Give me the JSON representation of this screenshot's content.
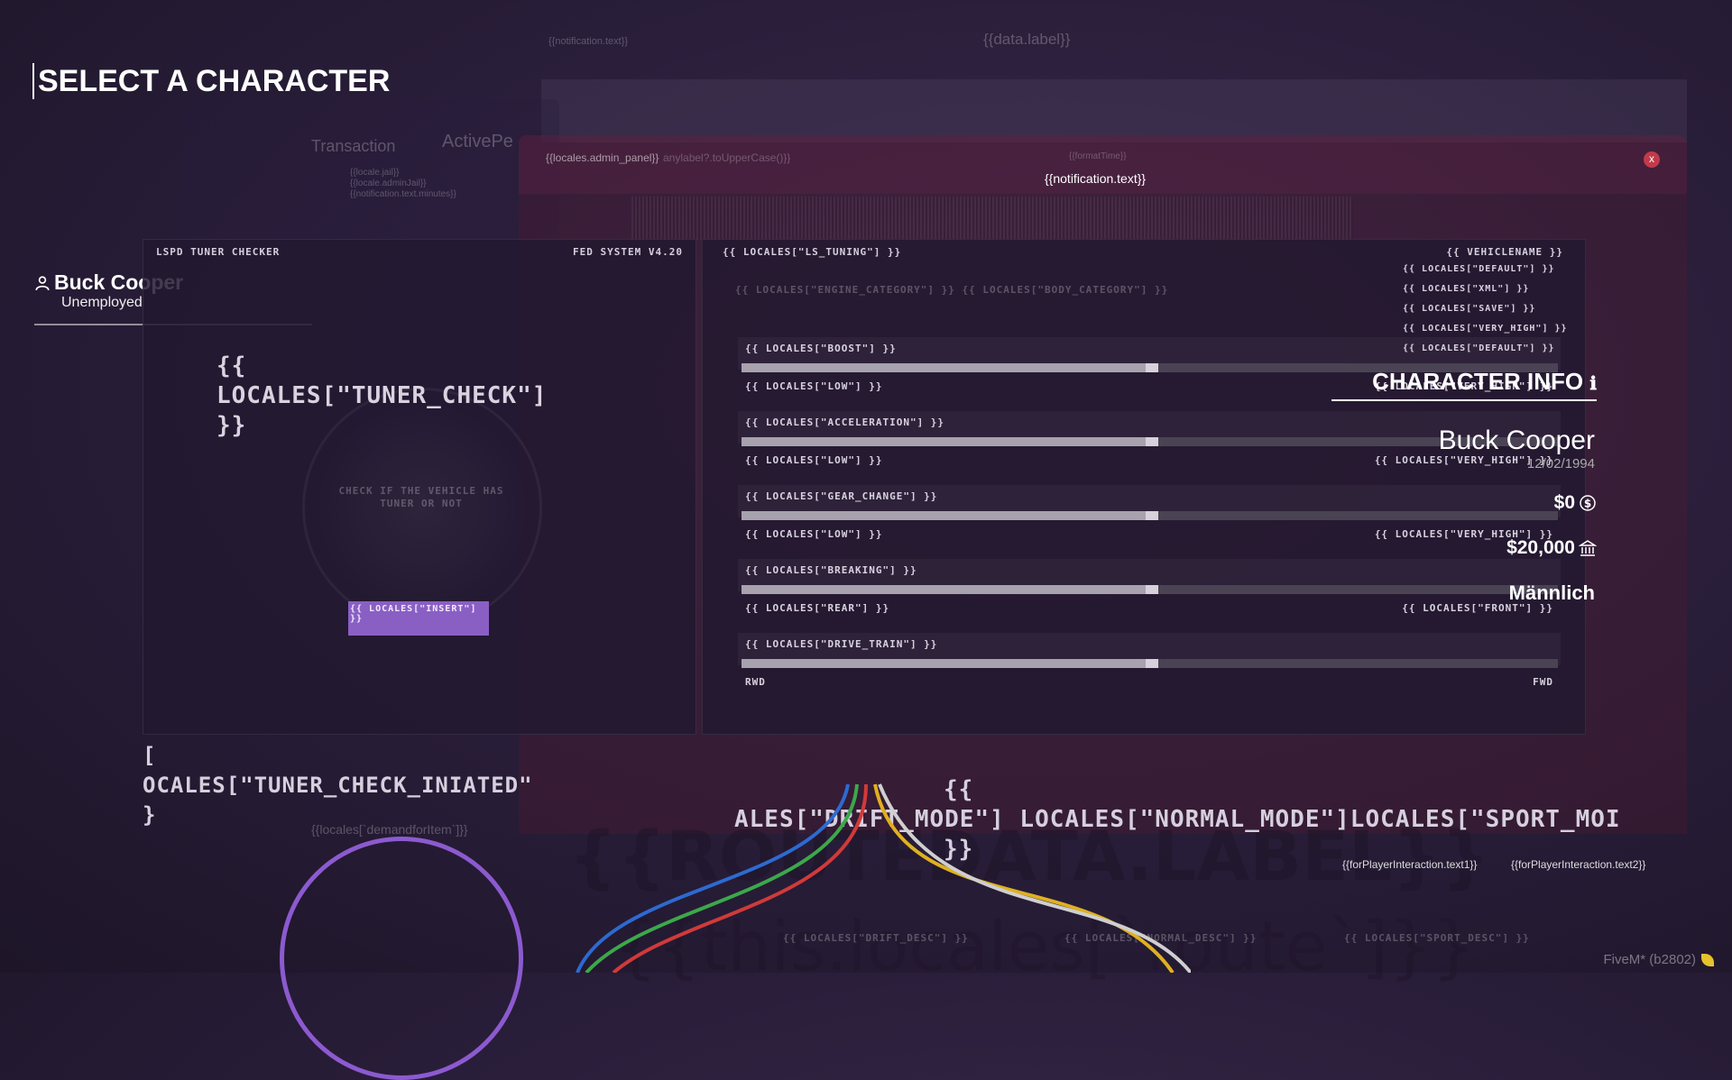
{
  "page": {
    "title": "SELECT A CHARACTER"
  },
  "character": {
    "name": "Buck Cooper",
    "job": "Unemployed"
  },
  "background": {
    "data_label": "{{data.label}}",
    "admin_panel": "{{locales.admin_panel}}",
    "upper_case": "anylabel?.toUpperCase()}}",
    "format_time": "{{formatTime}}",
    "notification": "{{notification.text}}",
    "notification_small": "{{notification.text}}",
    "transaction": "Transaction",
    "active": "ActivePe",
    "locale_jail": "{{locale.jail}}",
    "locale_admin_jail": "{{locale.adminJail}}",
    "notif_minutes": "{{notification.text.minutes}}",
    "demand": "{{locales[`demandforItem`]}}",
    "interaction1": "{{forPlayerInteraction.text1}}",
    "interaction2": "{{forPlayerInteraction.text2}}",
    "routedata": "{{ROUTEDATA.LABEL}}",
    "this_route": "{{this.locales[`route`]}}",
    "build": "FiveM* (b2802)"
  },
  "tuner": {
    "left_header": "LSPD TUNER CHECKER",
    "right_header": "FED SYSTEM V4.20",
    "title_open": "{{",
    "title_key": "LOCALES[\"TUNER_CHECK\"]",
    "title_close": "}}",
    "check_desc": "CHECK IF THE VEHICLE HAS TUNER OR NOT",
    "insert_button": "{{ LOCALES[\"INSERT\"] }}",
    "initiated_open": "[",
    "initiated": "OCALES[\"TUNER_CHECK_INIATED\"",
    "initiated_close": "}"
  },
  "tuning": {
    "header_left": "{{ LOCALES[\"LS_TUNING\"] }}",
    "header_right": "{{ VEHICLENAME }}",
    "tabs": "{{ LOCALES[\"ENGINE_CATEGORY\"]  }}   {{ LOCALES[\"BODY_CATEGORY\"] }}",
    "menu": [
      "{{ LOCALES[\"DEFAULT\"] }}",
      "{{ LOCALES[\"XML\"] }}",
      "{{ LOCALES[\"SAVE\"] }}",
      "{{ LOCALES[\"VERY_HIGH\"] }}",
      "{{ LOCALES[\"DEFAULT\"] }}"
    ],
    "stats": [
      {
        "label": "{{ LOCALES[\"BOOST\"] }}",
        "low": "{{ LOCALES[\"LOW\"] }}",
        "high": "{{ LOCALES[\"VERY_HIGH\"] }}",
        "value": 0.51
      },
      {
        "label": "{{ LOCALES[\"ACCELERATION\"] }}",
        "low": "{{ LOCALES[\"LOW\"] }}",
        "high": "{{ LOCALES[\"VERY_HIGH\"] }}",
        "value": 0.51
      },
      {
        "label": "{{ LOCALES[\"GEAR_CHANGE\"] }}",
        "low": "{{ LOCALES[\"LOW\"] }}",
        "high": "{{ LOCALES[\"VERY_HIGH\"] }}",
        "value": 0.51
      },
      {
        "label": "{{ LOCALES[\"BREAKING\"] }}",
        "low": "{{ LOCALES[\"REAR\"] }}",
        "high": "{{ LOCALES[\"FRONT\"] }}",
        "value": 0.51
      },
      {
        "label": "{{ LOCALES[\"DRIVE_TRAIN\"] }}",
        "low": "RWD",
        "high": "FWD",
        "value": 0.51
      }
    ],
    "modes_open": "{{",
    "modes": "ALES[\"DRIFT_MODE\"] LOCALES[\"NORMAL_MODE\"]LOCALES[\"SPORT_MOI",
    "modes_close": "}}",
    "mode_descs": [
      "{{ LOCALES[\"DRIFT_DESC\"] }}",
      "{{ LOCALES[\"NORMAL_DESC\"] }}",
      "{{ LOCALES[\"SPORT_DESC\"] }}"
    ]
  },
  "info": {
    "title": "CHARACTER INFO",
    "name": "Buck Cooper",
    "dob": "12/02/1994",
    "cash": "$0",
    "bank": "$20,000",
    "gender": "Männlich"
  },
  "close_label": "x",
  "colors": {
    "accent": "#8a5fc4",
    "circle": "#8c5ad0",
    "close": "#c23a4a"
  }
}
